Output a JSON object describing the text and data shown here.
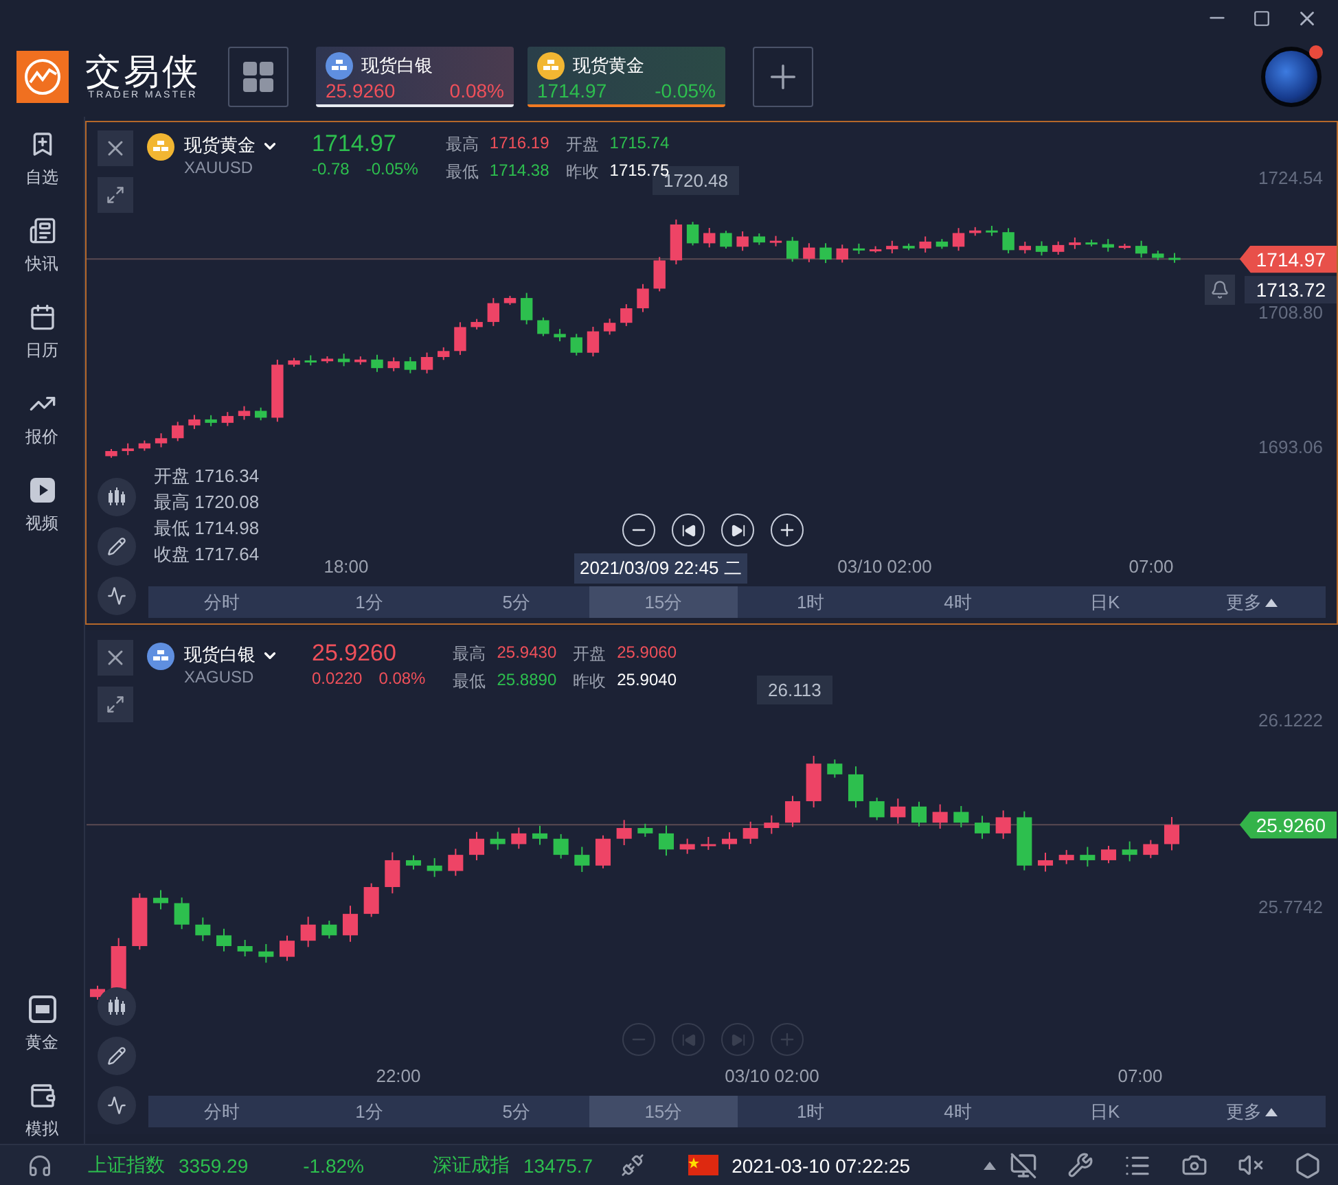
{
  "brand": {
    "name": "交易侠",
    "tagline": "TRADER MASTER"
  },
  "quote_tabs": [
    {
      "name": "现货白银",
      "kind": "silver",
      "price": "25.9260",
      "change": "0.08%",
      "color": "#f0505a",
      "selected": false
    },
    {
      "name": "现货黄金",
      "kind": "gold",
      "price": "1714.97",
      "change": "-0.05%",
      "color": "#2dbf4e",
      "selected": true
    }
  ],
  "sidebar": {
    "top": [
      {
        "label": "自选"
      },
      {
        "label": "快讯"
      },
      {
        "label": "日历"
      },
      {
        "label": "报价"
      },
      {
        "label": "视频"
      }
    ],
    "bottom": [
      {
        "label": "黄金"
      },
      {
        "label": "模拟"
      }
    ]
  },
  "panels": [
    {
      "name": "现货黄金",
      "symbol": "XAUUSD",
      "kind": "gold",
      "focused": true,
      "price": "1714.97",
      "color": "#2dbf4e",
      "change": "-0.78",
      "change_pct": "-0.05%",
      "stats": [
        {
          "label": "最高",
          "value": "1716.19",
          "color": "#f0505a"
        },
        {
          "label": "开盘",
          "value": "1715.74",
          "color": "#2dbf4e"
        },
        {
          "label": "最低",
          "value": "1714.38",
          "color": "#2dbf4e"
        },
        {
          "label": "昨收",
          "value": "1715.75",
          "color": "#ffffff"
        }
      ],
      "y_ticks": [
        "1724.54",
        "1708.80",
        "1693.06"
      ],
      "last_price": "1714.97",
      "cursor_price": "1713.72",
      "peak": "1720.48",
      "ohlc": [
        {
          "label": "开盘",
          "value": "1716.34"
        },
        {
          "label": "最高",
          "value": "1720.08"
        },
        {
          "label": "最低",
          "value": "1714.98"
        },
        {
          "label": "收盘",
          "value": "1717.64"
        }
      ],
      "x_ticks": [
        "18:00",
        "03/10 02:00",
        "07:00"
      ],
      "cursor_time": "2021/03/09 22:45 二",
      "nav_dim": false,
      "periods": [
        {
          "label": "分时",
          "selected": false
        },
        {
          "label": "1分",
          "selected": false
        },
        {
          "label": "5分",
          "selected": false
        },
        {
          "label": "15分",
          "selected": true
        },
        {
          "label": "1时",
          "selected": false
        },
        {
          "label": "4时",
          "selected": false
        },
        {
          "label": "日K",
          "selected": false
        },
        {
          "label": "更多",
          "selected": false
        }
      ]
    },
    {
      "name": "现货白银",
      "symbol": "XAGUSD",
      "kind": "silver",
      "focused": false,
      "price": "25.9260",
      "color": "#f0505a",
      "change": "0.0220",
      "change_pct": "0.08%",
      "stats": [
        {
          "label": "最高",
          "value": "25.9430",
          "color": "#f0505a"
        },
        {
          "label": "开盘",
          "value": "25.9060",
          "color": "#f0505a"
        },
        {
          "label": "最低",
          "value": "25.8890",
          "color": "#2dbf4e"
        },
        {
          "label": "昨收",
          "value": "25.9040",
          "color": "#ffffff"
        }
      ],
      "y_ticks": [
        "26.1222",
        "25.7742"
      ],
      "last_price": "25.9260",
      "peak": "26.113",
      "x_ticks": [
        "22:00",
        "03/10 02:00",
        "07:00"
      ],
      "nav_dim": true,
      "periods": [
        {
          "label": "分时",
          "selected": false
        },
        {
          "label": "1分",
          "selected": false
        },
        {
          "label": "5分",
          "selected": false
        },
        {
          "label": "15分",
          "selected": true
        },
        {
          "label": "1时",
          "selected": false
        },
        {
          "label": "4时",
          "selected": false
        },
        {
          "label": "日K",
          "selected": false
        },
        {
          "label": "更多",
          "selected": false
        }
      ]
    }
  ],
  "status_bar": {
    "indices": [
      {
        "name": "上证指数",
        "value": "3359.29",
        "change": "-1.82%",
        "color": "#2dbf4e"
      },
      {
        "name": "深证成指",
        "value": "13475.7",
        "color": "#2dbf4e"
      }
    ],
    "datetime": "2021-03-10 07:22:25"
  }
}
